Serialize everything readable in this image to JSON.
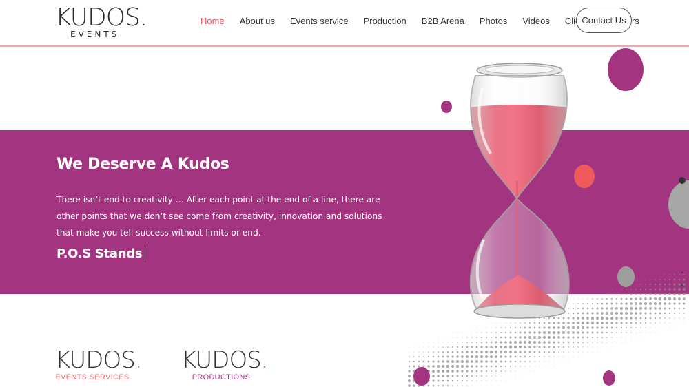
{
  "header": {
    "logo_text": "KUDOS",
    "logo_dot": ".",
    "logo_sub": "EVENTS",
    "nav": [
      {
        "label": "Home",
        "active": true
      },
      {
        "label": "About us"
      },
      {
        "label": "Events service"
      },
      {
        "label": "Production"
      },
      {
        "label": "B2B Arena"
      },
      {
        "label": "Photos"
      },
      {
        "label": "Videos"
      },
      {
        "label": "Clients"
      },
      {
        "label": "Careers"
      }
    ],
    "contact_label": "Contact Us"
  },
  "hero": {
    "title": "We Deserve A Kudos",
    "text": "There isn’t end to creativity … After each point at the end of a line, there are other points that we don’t see come from creativity, innovation and solutions that make you tell success without limits or end.",
    "subtitle": "P.O.S Stands"
  },
  "brands": [
    {
      "word": "KUDOS",
      "dot": ".",
      "sub": "EVENTS SERVICES"
    },
    {
      "word": "KUDOS",
      "dot": ".",
      "sub": "PRODUCTIONS"
    }
  ],
  "colors": {
    "accent_purple": "#a33580",
    "accent_coral": "#e2525b",
    "sand_red": "#e8304e"
  }
}
